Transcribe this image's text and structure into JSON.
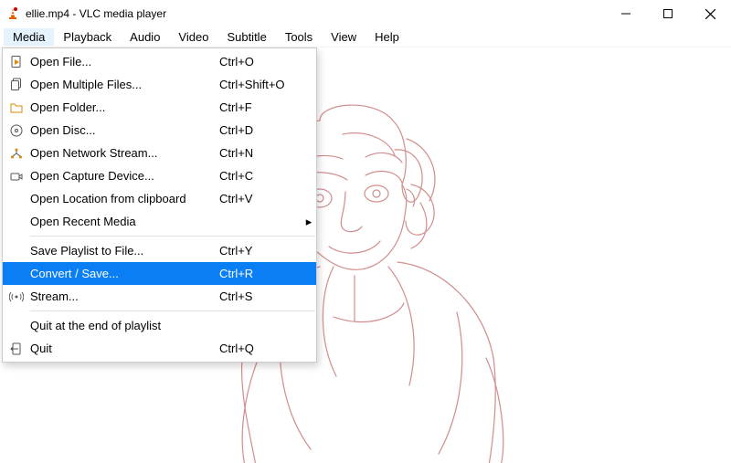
{
  "title": "ellie.mp4 - VLC media player",
  "menubar": {
    "items": [
      {
        "label": "Media"
      },
      {
        "label": "Playback"
      },
      {
        "label": "Audio"
      },
      {
        "label": "Video"
      },
      {
        "label": "Subtitle"
      },
      {
        "label": "Tools"
      },
      {
        "label": "View"
      },
      {
        "label": "Help"
      }
    ],
    "open_index": 0
  },
  "dropdown": {
    "items": [
      {
        "icon": "file-play",
        "label": "Open File...",
        "shortcut": "Ctrl+O"
      },
      {
        "icon": "files",
        "label": "Open Multiple Files...",
        "shortcut": "Ctrl+Shift+O"
      },
      {
        "icon": "folder",
        "label": "Open Folder...",
        "shortcut": "Ctrl+F"
      },
      {
        "icon": "disc",
        "label": "Open Disc...",
        "shortcut": "Ctrl+D"
      },
      {
        "icon": "network",
        "label": "Open Network Stream...",
        "shortcut": "Ctrl+N"
      },
      {
        "icon": "capture",
        "label": "Open Capture Device...",
        "shortcut": "Ctrl+C"
      },
      {
        "icon": "",
        "label": "Open Location from clipboard",
        "shortcut": "Ctrl+V"
      },
      {
        "icon": "",
        "label": "Open Recent Media",
        "shortcut": "",
        "submenu": true
      },
      {
        "sep": true
      },
      {
        "icon": "",
        "label": "Save Playlist to File...",
        "shortcut": "Ctrl+Y"
      },
      {
        "icon": "",
        "label": "Convert / Save...",
        "shortcut": "Ctrl+R",
        "highlight": true
      },
      {
        "icon": "stream",
        "label": "Stream...",
        "shortcut": "Ctrl+S"
      },
      {
        "sep": true
      },
      {
        "icon": "",
        "label": "Quit at the end of playlist",
        "shortcut": ""
      },
      {
        "icon": "quit",
        "label": "Quit",
        "shortcut": "Ctrl+Q"
      }
    ]
  }
}
